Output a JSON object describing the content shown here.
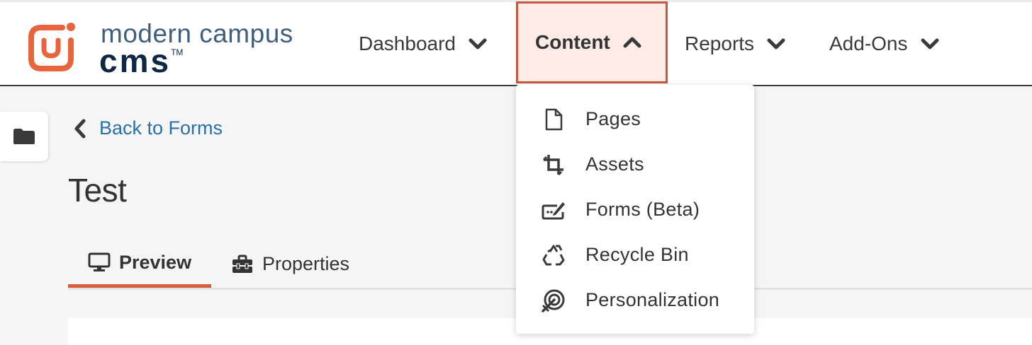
{
  "brand": {
    "name_top": "modern campus",
    "name_bottom": "cms",
    "trademark": "TM",
    "accent_color": "#e8643c"
  },
  "nav": {
    "items": [
      {
        "label": "Dashboard",
        "icon": "chevron-down-icon"
      },
      {
        "label": "Content",
        "icon": "chevron-up-icon",
        "active": true
      },
      {
        "label": "Reports",
        "icon": "chevron-down-icon"
      },
      {
        "label": "Add-Ons",
        "icon": "chevron-down-icon"
      }
    ]
  },
  "sidebar": {
    "toggle_icon": "folder-icon"
  },
  "back_link": {
    "label": "Back to Forms",
    "icon": "chevron-left-icon"
  },
  "page": {
    "title": "Test"
  },
  "tabs": [
    {
      "label": "Preview",
      "icon": "monitor-icon",
      "active": true
    },
    {
      "label": "Properties",
      "icon": "toolbox-icon"
    }
  ],
  "content_menu": {
    "items": [
      {
        "label": "Pages",
        "icon": "file-icon"
      },
      {
        "label": "Assets",
        "icon": "crop-icon"
      },
      {
        "label": "Forms (Beta)",
        "icon": "form-edit-icon"
      },
      {
        "label": "Recycle Bin",
        "icon": "recycle-icon"
      },
      {
        "label": "Personalization",
        "icon": "target-icon"
      }
    ]
  },
  "colors": {
    "active_nav_bg": "#fcebe6",
    "active_nav_border": "#c8573f",
    "link": "#2a6fa8",
    "tab_underline": "#d85c3e"
  }
}
